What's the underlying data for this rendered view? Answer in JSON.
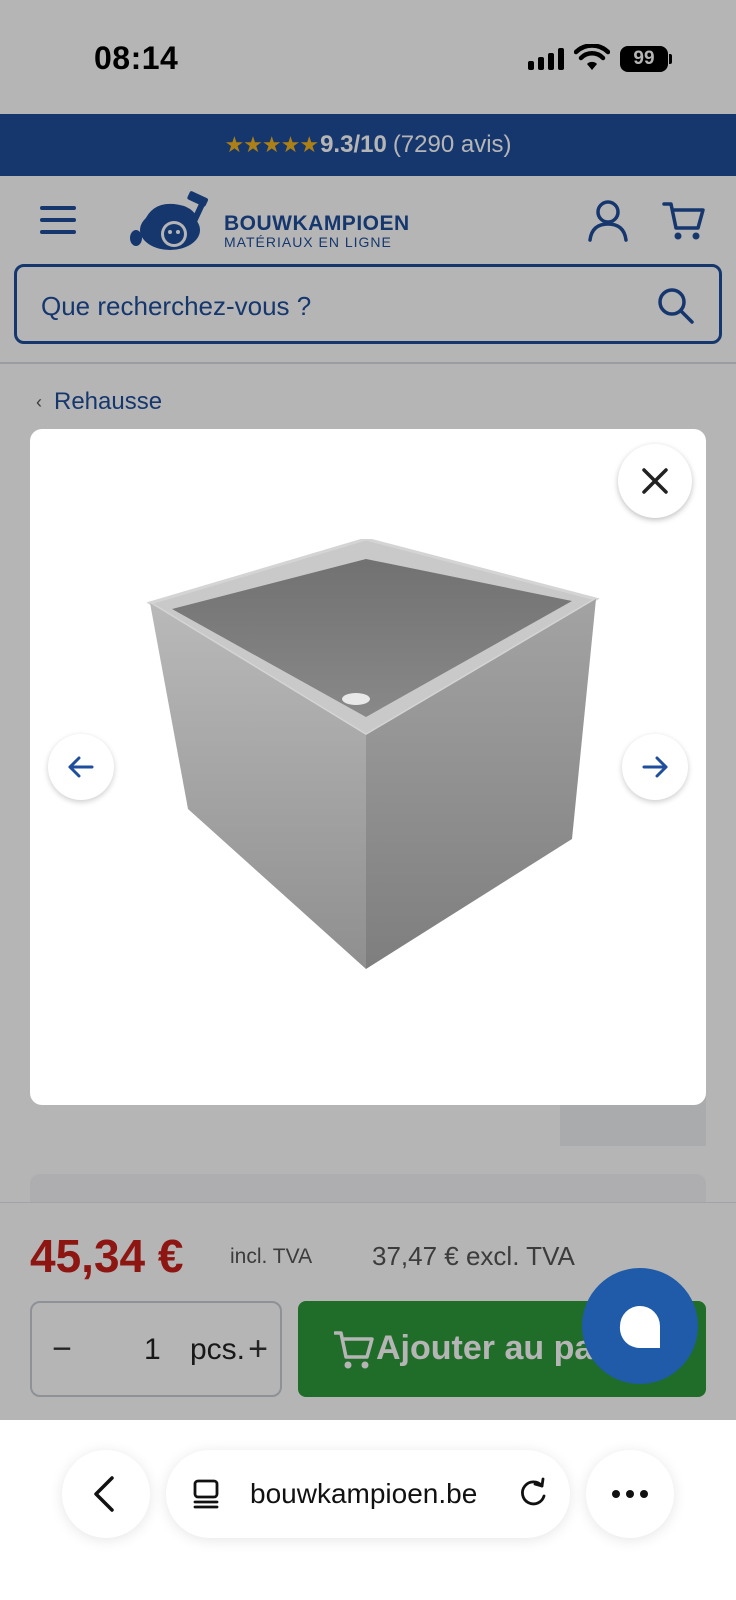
{
  "status_bar": {
    "time": "08:14",
    "battery": "99"
  },
  "rating_banner": {
    "stars": "★★★★★",
    "score": "9.3/10",
    "count": "(7290 avis)"
  },
  "header": {
    "brand": "BOUWKAMPIOEN",
    "tagline": "MATÉRIAUX EN LIGNE",
    "icons": [
      "menu-icon",
      "user-icon",
      "cart-icon"
    ]
  },
  "search": {
    "placeholder": "Que recherchez-vous ?"
  },
  "breadcrumb": {
    "label": "Rehausse"
  },
  "lightbox": {
    "image_alt": "concrete-riser",
    "icons": [
      "close-icon",
      "arrow-left-icon",
      "arrow-right-icon"
    ]
  },
  "purchase": {
    "price": "45,34 €",
    "incl_label": "incl. TVA",
    "excl_price": "37,47 € excl. TVA",
    "quantity": "1",
    "unit": "pcs.",
    "minus": "−",
    "plus": "+",
    "add_to_cart": "Ajouter au panier"
  },
  "browser": {
    "url": "bouwkampioen.be"
  },
  "colors": {
    "brand_blue": "#1f4e9c",
    "price_red": "#c8201a",
    "cta_green": "#2e9a3a",
    "star_yellow": "#f2b51f",
    "chat_blue": "#1f5ba8"
  }
}
